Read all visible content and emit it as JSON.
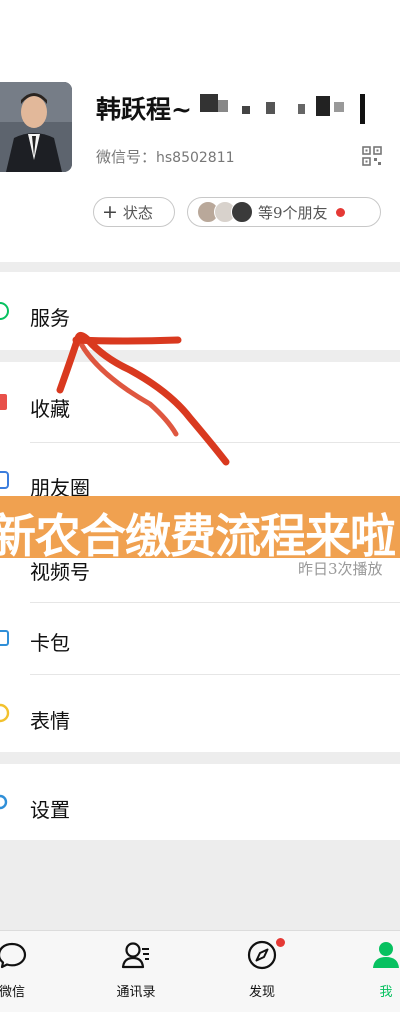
{
  "profile": {
    "name": "韩跃程~",
    "wechat_id_label": "微信号：",
    "wechat_id_value": "hs8502811",
    "status_button": "状态",
    "friends_chip": "等9个朋友"
  },
  "menu": {
    "services": "服务",
    "favorites": "收藏",
    "moments": "朋友圈",
    "channels": "视频号",
    "channels_note": "昨日3次播放",
    "cards": "卡包",
    "stickers": "表情",
    "settings": "设置"
  },
  "overlay_text": "新农合缴费流程来啦",
  "tabbar": {
    "chats": "微信",
    "contacts": "通讯录",
    "discover": "发现",
    "me": "我"
  },
  "colors": {
    "accent_green": "#07c160",
    "badge_red": "#e53935",
    "banner_orange": "#f0a150",
    "arrow_red": "#d9391f"
  },
  "icons": {
    "qr": "qr-code-icon",
    "chats": "chat-bubble-icon",
    "contacts": "contacts-icon",
    "discover": "compass-icon",
    "me": "person-icon"
  }
}
